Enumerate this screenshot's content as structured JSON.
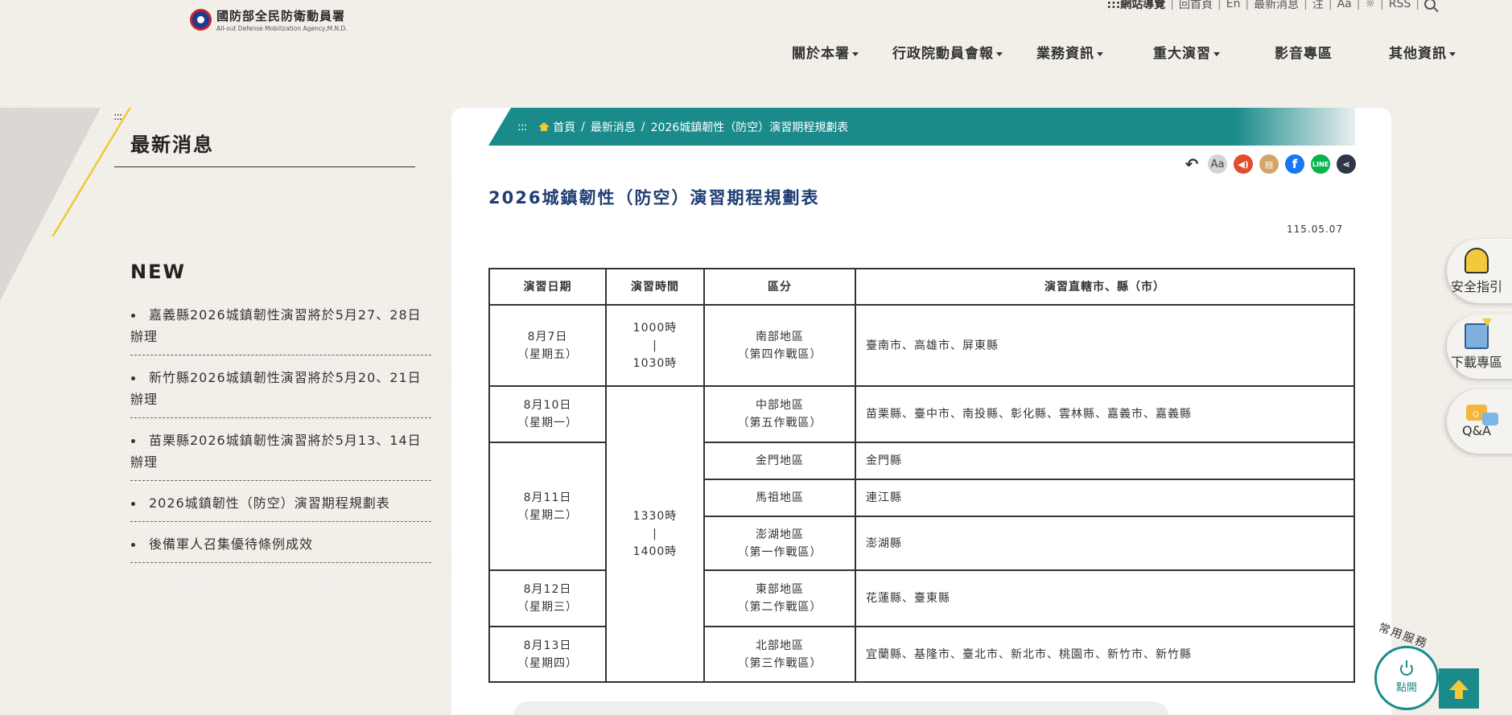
{
  "header": {
    "logo_cn": "國防部全民防衛動員署",
    "logo_en": "All-out Defense Mobilization Agency,M.N.D.",
    "top_links": [
      ":::網站導覽",
      "回首頁",
      "En",
      "最新消息",
      "注",
      "Aa",
      "RSS"
    ],
    "nav": [
      {
        "label": "關於本署",
        "dropdown": true
      },
      {
        "label": "行政院動員會報",
        "dropdown": true
      },
      {
        "label": "業務資訊",
        "dropdown": true
      },
      {
        "label": "重大演習",
        "dropdown": true
      },
      {
        "label": "影音專區",
        "dropdown": false
      },
      {
        "label": "其他資訊",
        "dropdown": true
      }
    ]
  },
  "sidebar": {
    "dots": ":::",
    "title": "最新消息",
    "new_title": "NEW",
    "news": [
      "嘉義縣2026城鎮韌性演習將於5月27、28日辦理",
      "新竹縣2026城鎮韌性演習將於5月20、21日辦理",
      "苗栗縣2026城鎮韌性演習將於5月13、14日辦理",
      "2026城鎮韌性（防空）演習期程規劃表",
      "後備軍人召集優待條例成效"
    ]
  },
  "breadcrumb": {
    "dots": ":::",
    "items": [
      "首頁",
      "最新消息",
      "2026城鎮韌性（防空）演習期程規劃表"
    ]
  },
  "tools": {
    "back": "↶",
    "font": "Aa",
    "speak": "◀)",
    "print": "▤",
    "facebook": "f",
    "line": "LINE",
    "share": "⋖"
  },
  "article": {
    "title": "2026城鎮韌性（防空）演習期程規劃表",
    "date": "115.05.07"
  },
  "table": {
    "headers": [
      "演習日期",
      "演習時間",
      "區分",
      "演習直轄市、縣（市）"
    ],
    "date_cells": [
      {
        "date": "8月7日",
        "weekday": "（星期五）"
      },
      {
        "date": "8月10日",
        "weekday": "（星期一）"
      },
      {
        "date": "8月11日",
        "weekday": "（星期二）"
      },
      {
        "date": "8月12日",
        "weekday": "（星期三）"
      },
      {
        "date": "8月13日",
        "weekday": "（星期四）"
      }
    ],
    "time_cells": [
      {
        "start": "1000時",
        "sep": "|",
        "end": "1030時"
      },
      {
        "start": "1330時",
        "sep": "|",
        "end": "1400時"
      }
    ],
    "rows": [
      {
        "region": "南部地區",
        "zone": "（第四作戰區）",
        "cities": "臺南市、高雄市、屏東縣"
      },
      {
        "region": "中部地區",
        "zone": "（第五作戰區）",
        "cities": "苗栗縣、臺中市、南投縣、彰化縣、雲林縣、嘉義市、嘉義縣"
      },
      {
        "region": "金門地區",
        "zone": "",
        "cities": "金門縣"
      },
      {
        "region": "馬祖地區",
        "zone": "",
        "cities": "連江縣"
      },
      {
        "region": "澎湖地區",
        "zone": "（第一作戰區）",
        "cities": "澎湖縣"
      },
      {
        "region": "東部地區",
        "zone": "（第二作戰區）",
        "cities": "花蓮縣、臺東縣"
      },
      {
        "region": "北部地區",
        "zone": "（第三作戰區）",
        "cities": "宜蘭縣、基隆市、臺北市、新北市、桃園市、新竹市、新竹縣"
      }
    ]
  },
  "floating": {
    "safety": "安全指引",
    "download": "下載專區",
    "qa": "Q&A",
    "qa_icon_text": "Q",
    "service_label": "常用服務",
    "service_button": "點開"
  },
  "colors": {
    "teal": "#1a8a8b",
    "title_blue": "#1f3d73",
    "accent_yellow": "#f1c93a"
  }
}
